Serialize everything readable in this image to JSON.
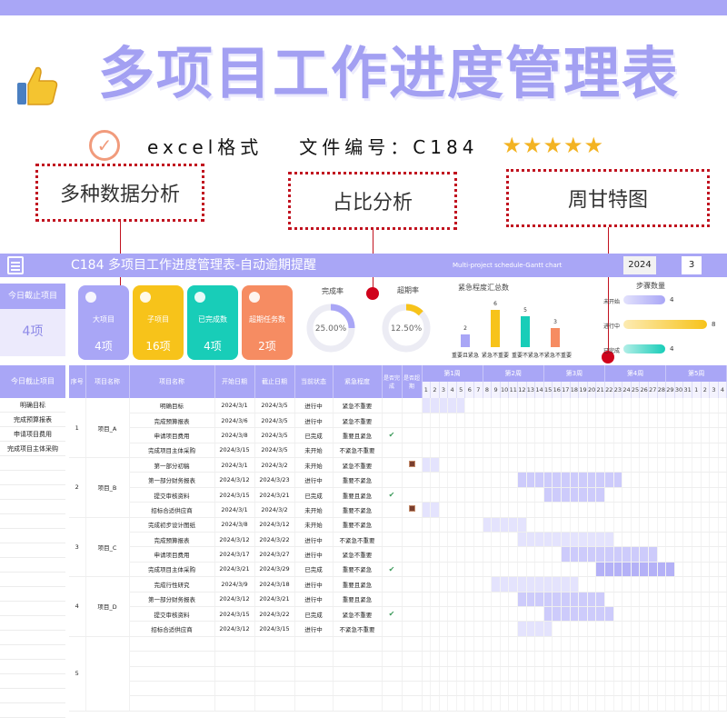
{
  "banner": {
    "title": "多项目工作进度管理表",
    "format": "excel格式",
    "file_no": "文件编号：C184",
    "stars": "★★★★★",
    "callouts": [
      "多种数据分析",
      "占比分析",
      "周甘特图"
    ]
  },
  "header": {
    "title": "C184 多项目工作进度管理表-自动逾期提醒",
    "subtitle": "Multi-project schedule-Gantt chart",
    "year": "2024",
    "month": "3"
  },
  "today_card": {
    "title": "今日截止项目",
    "value": "4项"
  },
  "kpis": [
    {
      "label": "大项目",
      "value": "4项",
      "color": "#a9a6f6"
    },
    {
      "label": "子项目",
      "value": "16项",
      "color": "#f7c31a"
    },
    {
      "label": "已完成数",
      "value": "4项",
      "color": "#18cdb8"
    },
    {
      "label": "超期任务数",
      "value": "2项",
      "color": "#f68c62"
    }
  ],
  "donuts": [
    {
      "title": "完成率",
      "label": "25.00%",
      "fraction": 0.25,
      "color": "#a9a6f6"
    },
    {
      "title": "超期率",
      "label": "12.50%",
      "fraction": 0.125,
      "color": "#f7c31a"
    }
  ],
  "chart_data": [
    {
      "type": "bar",
      "title": "紧急程度汇总数",
      "categories": [
        "重要且紧急",
        "紧急不重要",
        "重要不紧急",
        "不紧急不重要"
      ],
      "values": [
        2,
        6,
        5,
        3
      ],
      "colors": [
        "#a9a6f6",
        "#f7c31a",
        "#18cdb8",
        "#f68c62"
      ],
      "ylim": [
        0,
        7
      ]
    },
    {
      "type": "bar",
      "title": "步骤数量",
      "categories": [
        "未开始",
        "进行中",
        "已完成"
      ],
      "values": [
        4,
        8,
        4
      ],
      "colors": [
        "#a9a6f6",
        "#f7c31a",
        "#18cdb8"
      ],
      "xlim": [
        0,
        8
      ]
    }
  ],
  "side": {
    "title": "今日截止项目",
    "items": [
      "明确目标",
      "完成预算报表",
      "申请项目费用",
      "完成项目主体采购"
    ]
  },
  "table": {
    "columns": [
      "序号",
      "项目名称",
      "项目名称",
      "开始日期",
      "截止日期",
      "当前状态",
      "紧急程度",
      "是否完成",
      "是否超期"
    ],
    "weeks": [
      "第1周",
      "第2周",
      "第3周",
      "第4周",
      "第5周"
    ],
    "days": [
      "1",
      "2",
      "3",
      "4",
      "5",
      "6",
      "7",
      "8",
      "9",
      "10",
      "11",
      "12",
      "13",
      "14",
      "15",
      "16",
      "17",
      "18",
      "19",
      "20",
      "21",
      "22",
      "23",
      "24",
      "25",
      "26",
      "27",
      "28",
      "29",
      "30",
      "31",
      "1",
      "2",
      "3",
      "4"
    ],
    "groups": [
      {
        "no": "1",
        "name": "项目_A",
        "rows": [
          {
            "task": "明确目标",
            "start": "2024/3/1",
            "end": "2024/3/5",
            "status": "进行中",
            "urgency": "紧急不重要",
            "done": "",
            "late": "",
            "g": [
              1,
              5,
              1
            ]
          },
          {
            "task": "完成预算报表",
            "start": "2024/3/6",
            "end": "2024/3/5",
            "status": "进行中",
            "urgency": "紧急不重要",
            "done": "",
            "late": "",
            "g": [
              0,
              0,
              0
            ]
          },
          {
            "task": "申请项目费用",
            "start": "2024/3/8",
            "end": "2024/3/5",
            "status": "已完成",
            "urgency": "重要且紧急",
            "done": "✔",
            "late": "",
            "g": [
              0,
              0,
              0
            ]
          },
          {
            "task": "完成项目主体采购",
            "start": "2024/3/15",
            "end": "2024/3/5",
            "status": "未开始",
            "urgency": "不紧急不重要",
            "done": "",
            "late": "",
            "g": [
              0,
              0,
              0
            ]
          }
        ]
      },
      {
        "no": "2",
        "name": "项目_B",
        "rows": [
          {
            "task": "第一部分初稿",
            "start": "2024/3/1",
            "end": "2024/3/2",
            "status": "未开始",
            "urgency": "紧急不重要",
            "done": "",
            "late": "■",
            "g": [
              1,
              2,
              1
            ]
          },
          {
            "task": "第一部分财务报表",
            "start": "2024/3/12",
            "end": "2024/3/23",
            "status": "进行中",
            "urgency": "重要不紧急",
            "done": "",
            "late": "",
            "g": [
              12,
              23,
              2
            ]
          },
          {
            "task": "提交审核资料",
            "start": "2024/3/15",
            "end": "2024/3/21",
            "status": "已完成",
            "urgency": "重要且紧急",
            "done": "✔",
            "late": "",
            "g": [
              15,
              21,
              2
            ]
          },
          {
            "task": "招标合适供应商",
            "start": "2024/3/1",
            "end": "2024/3/2",
            "status": "未开始",
            "urgency": "重要不紧急",
            "done": "",
            "late": "■",
            "g": [
              1,
              2,
              1
            ]
          }
        ]
      },
      {
        "no": "3",
        "name": "项目_C",
        "rows": [
          {
            "task": "完成初步设计图纸",
            "start": "2024/3/8",
            "end": "2024/3/12",
            "status": "未开始",
            "urgency": "重要不紧急",
            "done": "",
            "late": "",
            "g": [
              8,
              12,
              1
            ]
          },
          {
            "task": "完成预算报表",
            "start": "2024/3/12",
            "end": "2024/3/22",
            "status": "进行中",
            "urgency": "不紧急不重要",
            "done": "",
            "late": "",
            "g": [
              12,
              22,
              1
            ]
          },
          {
            "task": "申请项目费用",
            "start": "2024/3/17",
            "end": "2024/3/27",
            "status": "进行中",
            "urgency": "紧急不重要",
            "done": "",
            "late": "",
            "g": [
              17,
              27,
              2
            ]
          },
          {
            "task": "完成项目主体采购",
            "start": "2024/3/21",
            "end": "2024/3/29",
            "status": "已完成",
            "urgency": "重要不紧急",
            "done": "✔",
            "late": "",
            "g": [
              21,
              29,
              3
            ]
          }
        ]
      },
      {
        "no": "4",
        "name": "项目_D",
        "rows": [
          {
            "task": "完成行性研究",
            "start": "2024/3/9",
            "end": "2024/3/18",
            "status": "进行中",
            "urgency": "重要且紧急",
            "done": "",
            "late": "",
            "g": [
              9,
              18,
              1
            ]
          },
          {
            "task": "第一部分财务报表",
            "start": "2024/3/12",
            "end": "2024/3/21",
            "status": "进行中",
            "urgency": "重要且紧急",
            "done": "",
            "late": "",
            "g": [
              12,
              21,
              2
            ]
          },
          {
            "task": "提交审核资料",
            "start": "2024/3/15",
            "end": "2024/3/22",
            "status": "已完成",
            "urgency": "紧急不重要",
            "done": "✔",
            "late": "",
            "g": [
              15,
              22,
              2
            ]
          },
          {
            "task": "招标合适供应商",
            "start": "2024/3/12",
            "end": "2024/3/15",
            "status": "进行中",
            "urgency": "不紧急不重要",
            "done": "",
            "late": "",
            "g": [
              12,
              15,
              1
            ]
          }
        ]
      },
      {
        "no": "5",
        "name": "",
        "rows": [
          {
            "task": "",
            "start": "",
            "end": "",
            "status": "",
            "urgency": "",
            "done": "",
            "late": "",
            "g": [
              0,
              0,
              0
            ]
          },
          {
            "task": "",
            "start": "",
            "end": "",
            "status": "",
            "urgency": "",
            "done": "",
            "late": "",
            "g": [
              0,
              0,
              0
            ]
          },
          {
            "task": "",
            "start": "",
            "end": "",
            "status": "",
            "urgency": "",
            "done": "",
            "late": "",
            "g": [
              0,
              0,
              0
            ]
          },
          {
            "task": "",
            "start": "",
            "end": "",
            "status": "",
            "urgency": "",
            "done": "",
            "late": "",
            "g": [
              0,
              0,
              0
            ]
          },
          {
            "task": "",
            "start": "",
            "end": "",
            "status": "",
            "urgency": "",
            "done": "",
            "late": "",
            "g": [
              0,
              0,
              0
            ]
          }
        ]
      }
    ]
  }
}
